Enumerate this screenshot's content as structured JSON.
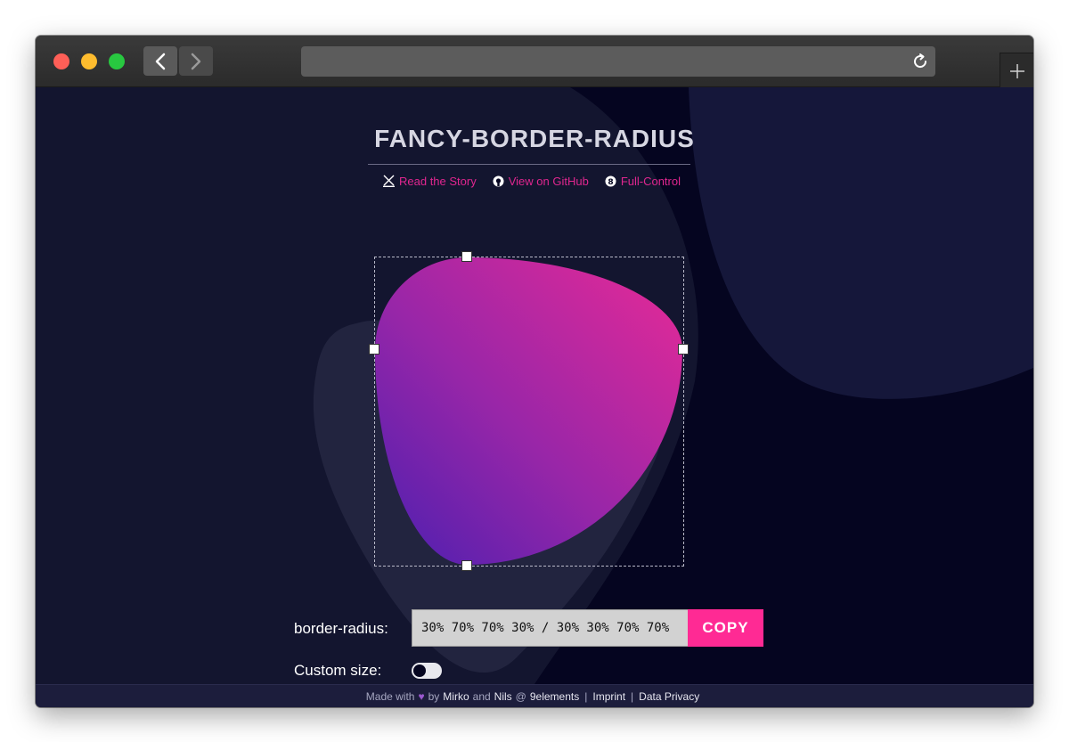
{
  "browser": {
    "url": ""
  },
  "page": {
    "title": "FANCY-BORDER-RADIUS",
    "links": [
      {
        "label": "Read the Story",
        "icon": "medium-icon"
      },
      {
        "label": "View on GitHub",
        "icon": "github-icon"
      },
      {
        "label": "Full-Control",
        "icon": "eight-circle-icon"
      }
    ],
    "shape": {
      "border_radius": "30% 70% 70% 30% / 30% 30% 70% 70%",
      "gradient_start": "#4a1fb0",
      "gradient_end": "#e92a96"
    },
    "controls": {
      "radius_label": "border-radius:",
      "radius_value": "30% 70% 70% 30% / 30% 30% 70% 70%",
      "copy_label": "COPY",
      "size_label": "Custom size:",
      "custom_size_enabled": false
    }
  },
  "footer": {
    "made_with": "Made with",
    "by": "by",
    "author1": "Mirko",
    "and": "and",
    "author2": "Nils",
    "at": "@",
    "company": "9elements",
    "imprint": "Imprint",
    "privacy": "Data Privacy"
  },
  "colors": {
    "accent": "#ff2a94",
    "background": "#050520",
    "link": "#e0268f"
  }
}
